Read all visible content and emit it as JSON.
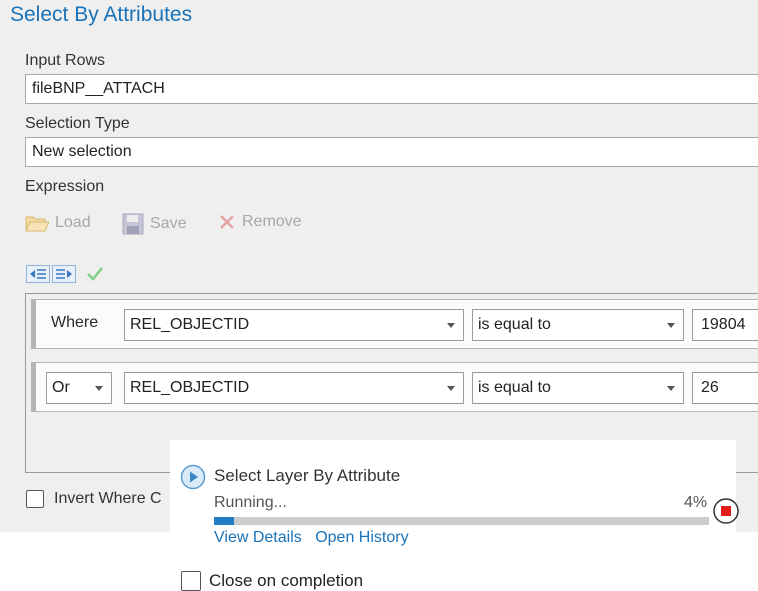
{
  "title": "Select By Attributes",
  "input_rows": {
    "label": "Input Rows",
    "value": "fileBNP__ATTACH"
  },
  "selection_type": {
    "label": "Selection Type",
    "value": "New selection"
  },
  "expression": {
    "label": "Expression",
    "toolbar": {
      "load": "Load",
      "save": "Save",
      "remove": "Remove"
    },
    "clauses": [
      {
        "connector": "Where",
        "field": "REL_OBJECTID",
        "operator": "is equal to",
        "value": "19804"
      },
      {
        "connector": "Or",
        "field": "REL_OBJECTID",
        "operator": "is equal to",
        "value": "26"
      }
    ]
  },
  "invert_where": {
    "label": "Invert Where C"
  },
  "progress": {
    "tool_name": "Select Layer By Attribute",
    "status": "Running...",
    "percent_label": "4%",
    "percent": 4,
    "view_details": "View Details",
    "open_history": "Open History"
  },
  "close_on_completion": {
    "label": "Close on completion"
  }
}
